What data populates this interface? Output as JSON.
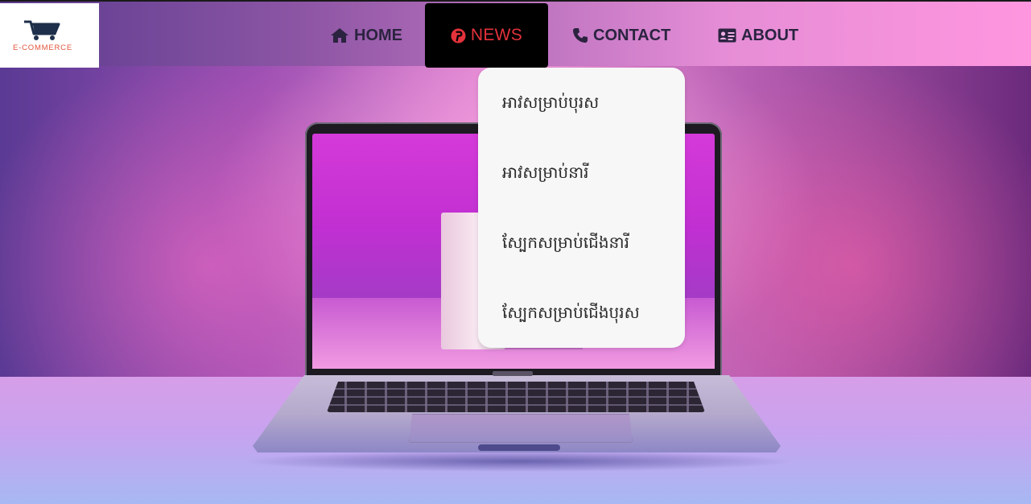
{
  "brand": {
    "logo_text": "E-COMMERCE",
    "logo_icon": "shopping-cart-icon",
    "accent_color": "#e2553a"
  },
  "nav": {
    "items": [
      {
        "label": "HOME",
        "icon": "home-icon"
      },
      {
        "label": "NEWS",
        "icon": "pinterest-icon",
        "active": true,
        "active_color": "#e3323b"
      },
      {
        "label": "CONTACT",
        "icon": "phone-icon"
      },
      {
        "label": "ABOUT",
        "icon": "id-card-icon"
      }
    ]
  },
  "dropdown": {
    "items": [
      {
        "label": "អាវសម្រាប់បុរស"
      },
      {
        "label": "អាវសម្រាប់នារី"
      },
      {
        "label": "ស្បែកសម្រាប់ជើងនារី"
      },
      {
        "label": "ស្បែកសម្រាប់ជើងបុរស"
      }
    ]
  },
  "hero": {
    "image": "laptop-on-table-photo"
  }
}
